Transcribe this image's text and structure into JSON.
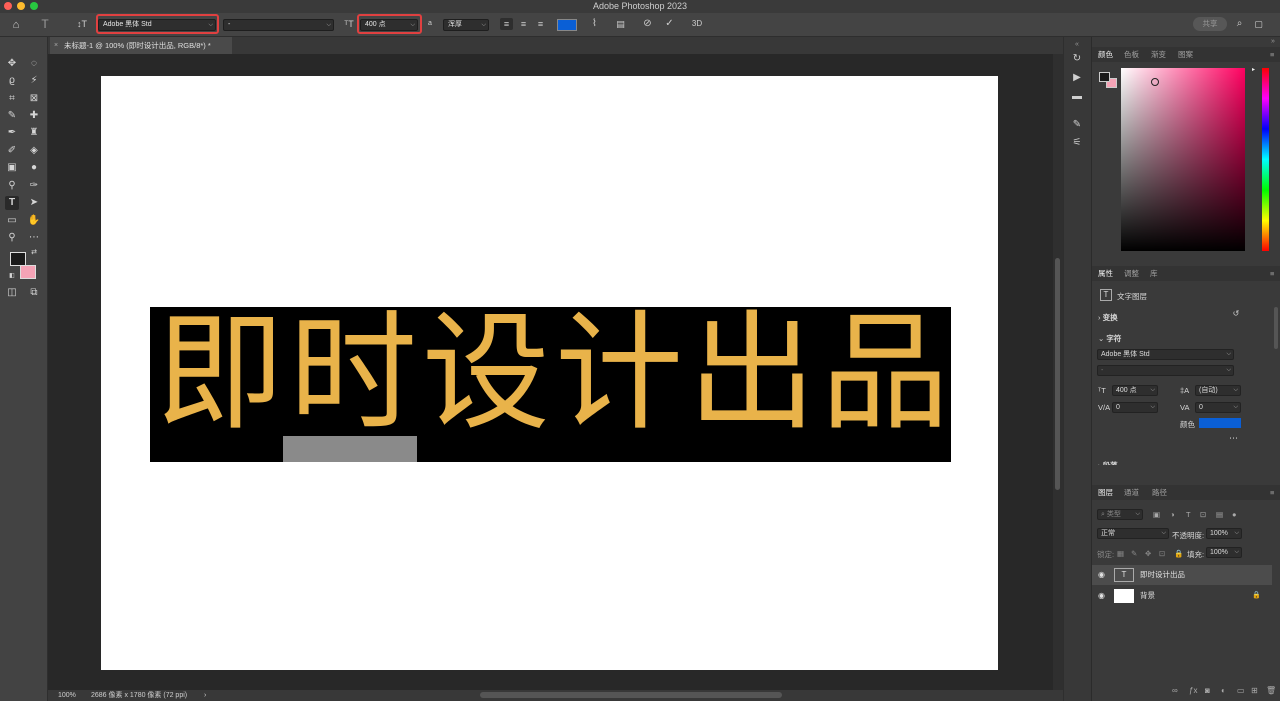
{
  "window": {
    "title": "Adobe Photoshop 2023"
  },
  "options_bar": {
    "font_family": "Adobe 黑体 Std",
    "font_style": "-",
    "font_size": "400 点",
    "antialias_label": "a",
    "antialias": "浑厚",
    "text_color": "#0a5fd6",
    "share_label": "共享",
    "three_d_label": "3D"
  },
  "document": {
    "tab_title": "未标题-1 @ 100% (即时设计出品, RGB/8*) *",
    "canvas_text": "即时设计出品"
  },
  "status": {
    "zoom": "100%",
    "info": "2686 像素 x 1780 像素 (72 ppi)"
  },
  "color_panel": {
    "tabs": [
      "颜色",
      "色板",
      "渐变",
      "图案"
    ],
    "fg": "#1a1a1a",
    "bg": "#f5a3b6"
  },
  "properties_panel": {
    "tabs": [
      "属性",
      "调整",
      "库"
    ],
    "layer_type": "文字图层",
    "transform": "变换",
    "character": "字符",
    "font_family": "Adobe 黑体 Std",
    "font_style": "-",
    "size": "400 点",
    "leading": "(自动)",
    "kerning": "0",
    "tracking": "0",
    "color_label": "颜色",
    "color": "#0a5fd6",
    "paragraph": "段落"
  },
  "layers_panel": {
    "tabs": [
      "图层",
      "通道",
      "路径"
    ],
    "filter_placeholder": "类型",
    "blend_mode": "正常",
    "opacity_label": "不透明度:",
    "opacity": "100%",
    "lock_label": "锁定:",
    "fill_label": "填充:",
    "fill": "100%",
    "layers": [
      {
        "name": "即时设计出品",
        "type": "text"
      },
      {
        "name": "背景",
        "type": "background"
      }
    ]
  }
}
